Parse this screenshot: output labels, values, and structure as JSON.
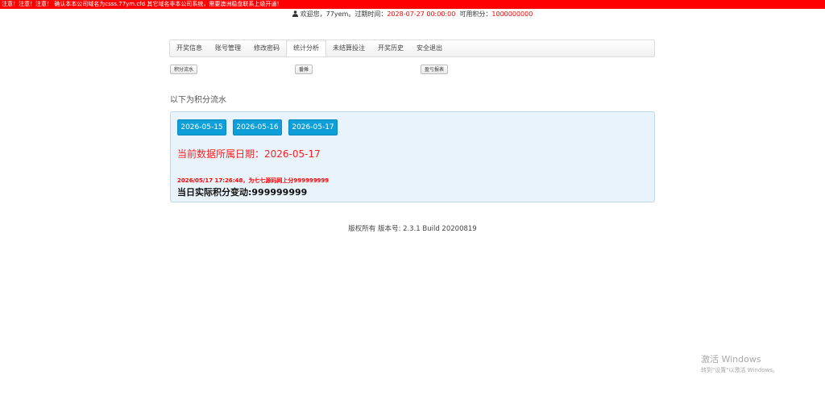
{
  "warning_bar": {
    "text": "注意！注意！注意！ 确认本本公司域名为csss.77ym.cfd 其它域名非本公司系统，需要澳洲稳盘联系上级开通！",
    "color": "#ff0000"
  },
  "welcome": {
    "icon": "user-icon",
    "prefix": "欢迎您，77yem。过期时间：",
    "expire_time": "2028-07-27 00:00:00",
    "points_label": "可用积分：",
    "points_value": "1000000000"
  },
  "nav": {
    "items": [
      {
        "label": "开奖信息"
      },
      {
        "label": "账号管理"
      },
      {
        "label": "修改密码"
      },
      {
        "label": "统计分析",
        "active": true
      },
      {
        "label": "未结算投注"
      },
      {
        "label": "开奖历史"
      },
      {
        "label": "安全退出"
      }
    ]
  },
  "subnav": {
    "buttons": [
      {
        "label": "积分流水"
      },
      {
        "label": "番摊"
      },
      {
        "label": "盈亏报表"
      }
    ]
  },
  "section_title": "以下为积分流水",
  "panel": {
    "dates": [
      "2026-05-15",
      "2026-05-16",
      "2026-05-17"
    ],
    "current_date_text": "当前数据所属日期：2026-05-17",
    "log_line": "2026/05/17 17:26:48，为七七源码网上分999999999",
    "change_text": "当日实际积分变动:999999999",
    "accent_color": "#0e9fd8"
  },
  "footer": {
    "text": "版权所有 版本号: 2.3.1 Build 20200819"
  },
  "windows_watermark": {
    "line1": "激活 Windows",
    "line2": "转到\"设置\"以激活 Windows。"
  }
}
